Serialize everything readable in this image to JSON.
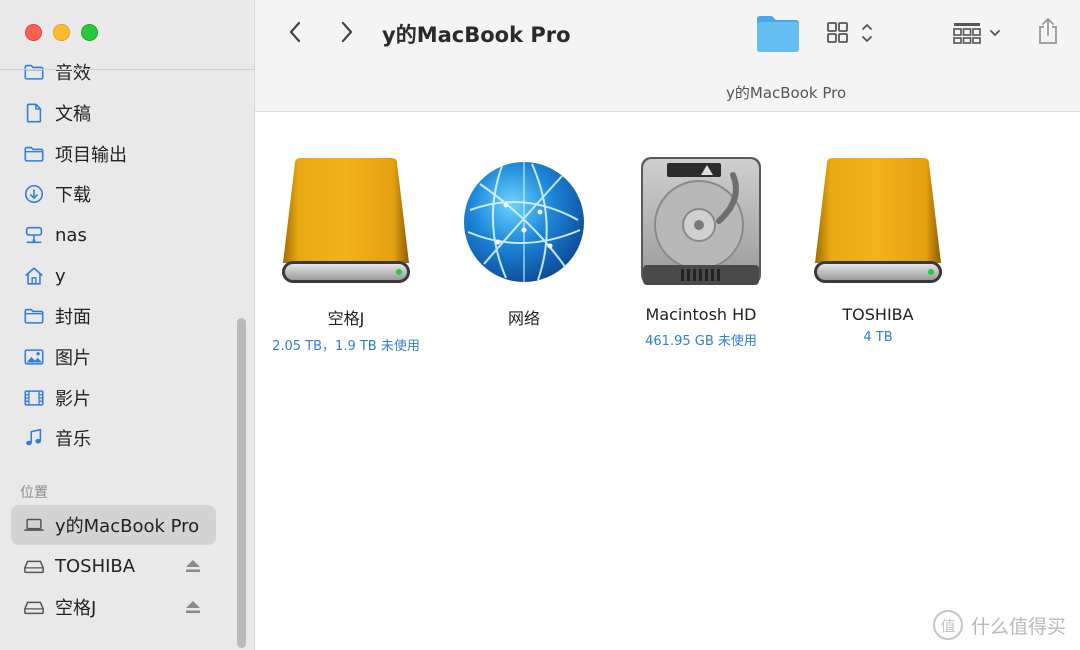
{
  "window": {
    "title": "y的MacBook Pro",
    "path_title": "y的MacBook Pro"
  },
  "toolbar": {
    "back_icon": "chevron-left-icon",
    "forward_icon": "chevron-right-icon",
    "folder_icon": "folder-icon",
    "view_icon": "grid-view-icon",
    "group_icon": "group-by-icon",
    "share_icon": "share-icon"
  },
  "sidebar": {
    "items": [
      {
        "label": "音效",
        "icon": "folder-icon"
      },
      {
        "label": "文稿",
        "icon": "document-icon"
      },
      {
        "label": "项目输出",
        "icon": "folder-icon"
      },
      {
        "label": "下载",
        "icon": "download-icon"
      },
      {
        "label": "nas",
        "icon": "network-drive-icon"
      },
      {
        "label": "y",
        "icon": "home-icon"
      },
      {
        "label": "封面",
        "icon": "folder-icon"
      },
      {
        "label": "图片",
        "icon": "pictures-icon"
      },
      {
        "label": "影片",
        "icon": "movies-icon"
      },
      {
        "label": "音乐",
        "icon": "music-icon"
      }
    ],
    "section_label": "位置",
    "locations": [
      {
        "label": "y的MacBook Pro",
        "icon": "laptop-icon",
        "active": true
      },
      {
        "label": "TOSHIBA",
        "icon": "drive-icon",
        "eject": true
      },
      {
        "label": "空格J",
        "icon": "drive-icon",
        "eject": true
      }
    ]
  },
  "volumes": [
    {
      "name": "空格J",
      "info": "2.05 TB，1.9 TB 未使用",
      "icon": "external-drive-icon"
    },
    {
      "name": "网络",
      "info": "",
      "icon": "network-globe-icon"
    },
    {
      "name": "Macintosh HD",
      "info": "461.95 GB 未使用",
      "icon": "internal-disk-icon"
    },
    {
      "name": "TOSHIBA",
      "info": "4 TB",
      "icon": "external-drive-icon"
    }
  ],
  "watermark": {
    "logo": "值",
    "text": "什么值得买"
  },
  "colors": {
    "accent": "#2f7ed8",
    "folder": "#5ab4ee",
    "drive_gold": "#e0a01a"
  }
}
